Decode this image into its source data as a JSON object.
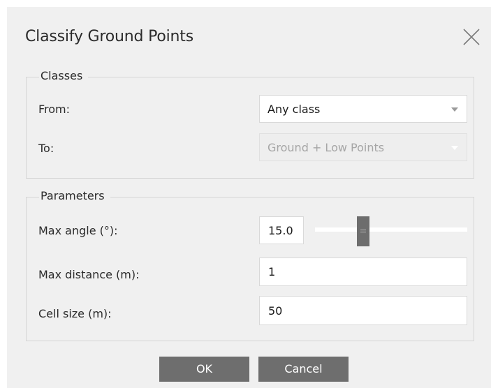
{
  "dialog": {
    "title": "Classify Ground Points",
    "close_icon": "close-icon"
  },
  "classes": {
    "group_label": "Classes",
    "from_label": "From:",
    "from_value": "Any class",
    "to_label": "To:",
    "to_value": "Ground + Low Points"
  },
  "parameters": {
    "group_label": "Parameters",
    "max_angle_label": "Max angle (°):",
    "max_angle_value": "15.0",
    "max_angle_slider_fraction": 0.3,
    "max_distance_label": "Max distance (m):",
    "max_distance_value": "1",
    "cell_size_label": "Cell size (m):",
    "cell_size_value": "50"
  },
  "buttons": {
    "ok_label": "OK",
    "cancel_label": "Cancel"
  },
  "colors": {
    "dialog_bg": "#f0f0f0",
    "button_bg": "#6e6e6e",
    "slider_thumb": "#6d6d6d",
    "border": "#d5d5d5"
  }
}
